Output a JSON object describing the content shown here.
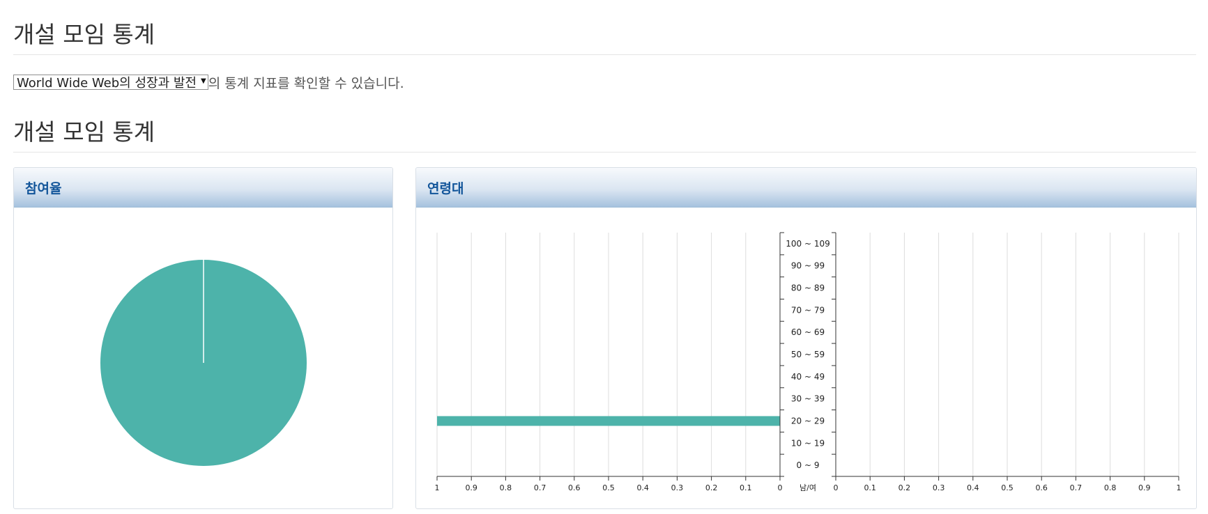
{
  "page": {
    "heading_top": "개설 모임 통계",
    "select_value": "World Wide Web의 성장과 발전",
    "select_suffix": "의 통계 지표를 확인할 수 있습니다.",
    "heading_stats": "개설 모임 통계"
  },
  "panels": {
    "participation_title": "참여율",
    "age_title": "연령대"
  },
  "colors": {
    "series": "#4db3aa",
    "panel_title": "#12559a"
  },
  "chart_data": [
    {
      "type": "pie",
      "slices": [
        {
          "value": 1.0
        }
      ]
    },
    {
      "type": "bar",
      "orientation": "horizontal",
      "categories": [
        "0 ~ 9",
        "10 ~ 19",
        "20 ~ 29",
        "30 ~ 39",
        "40 ~ 49",
        "50 ~ 59",
        "60 ~ 69",
        "70 ~ 79",
        "80 ~ 89",
        "90 ~ 99",
        "100 ~ 109"
      ],
      "center_label": "남/여",
      "left": {
        "values": [
          0,
          0,
          1,
          0,
          0,
          0,
          0,
          0,
          0,
          0,
          0
        ],
        "ticks": [
          "1",
          "0.9",
          "0.8",
          "0.7",
          "0.6",
          "0.5",
          "0.4",
          "0.3",
          "0.2",
          "0.1",
          "0"
        ]
      },
      "right": {
        "values": [
          0,
          0,
          0,
          0,
          0,
          0,
          0,
          0,
          0,
          0,
          0
        ],
        "ticks": [
          "0",
          "0.1",
          "0.2",
          "0.3",
          "0.4",
          "0.5",
          "0.6",
          "0.7",
          "0.8",
          "0.9",
          "1"
        ]
      },
      "xlim": [
        0,
        1
      ],
      "grid": true
    }
  ]
}
